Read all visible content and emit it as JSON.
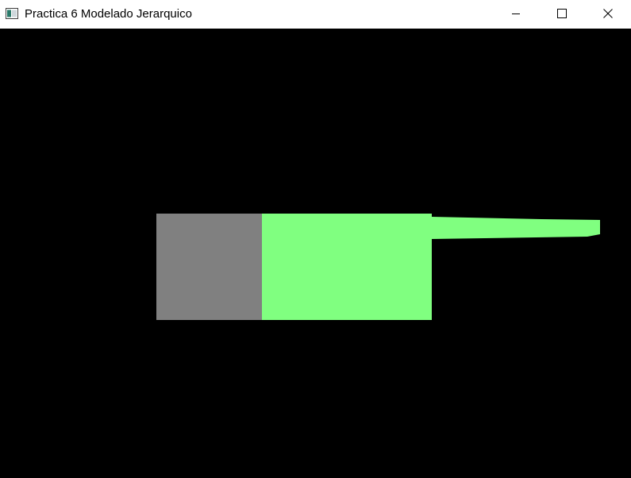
{
  "window": {
    "title": "Practica 6 Modelado Jerarquico",
    "icon": "app-window-icon",
    "controls": {
      "minimize_icon": "minimize-icon",
      "maximize_icon": "maximize-icon",
      "close_icon": "close-icon"
    }
  },
  "canvas": {
    "background_color": "#000000",
    "shapes": [
      {
        "name": "gray-block",
        "color": "#808080"
      },
      {
        "name": "green-block",
        "color": "#80ff80"
      },
      {
        "name": "green-arm",
        "color": "#80ff80"
      }
    ]
  }
}
